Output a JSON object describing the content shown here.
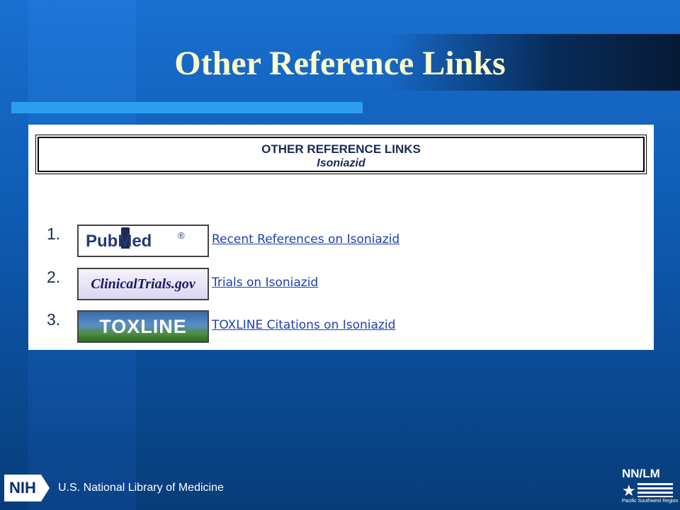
{
  "slide": {
    "title": "Other Reference Links"
  },
  "panel": {
    "header_title": "OTHER REFERENCE LINKS",
    "header_subtitle": "Isoniazid",
    "links": [
      {
        "number": "1.",
        "logo_text": "PubMed",
        "logo_mark": "®",
        "link_text": "Recent References on Isoniazid",
        "logo_icon": "pubmed-logo"
      },
      {
        "number": "2.",
        "logo_text": "ClinicalTrials.gov",
        "link_text": "Trials on Isoniazid",
        "logo_icon": "clinicaltrials-logo"
      },
      {
        "number": "3.",
        "logo_text": "TOXLINE",
        "link_text": "TOXLINE Citations on Isoniazid",
        "logo_icon": "toxline-logo"
      }
    ]
  },
  "footer": {
    "nih_mark": "NIH",
    "nih_label": "U.S. National Library of Medicine",
    "nnlm_title": "NN/LM",
    "nnlm_subtitle": "Pacific Southwest Region",
    "nnlm_star": "★"
  },
  "colors": {
    "background_top": "#1a6fd0",
    "background_bottom": "#073c79",
    "title": "#ffffcc",
    "accent_bar": "#2e9ef0",
    "link": "#1e3fb0"
  }
}
